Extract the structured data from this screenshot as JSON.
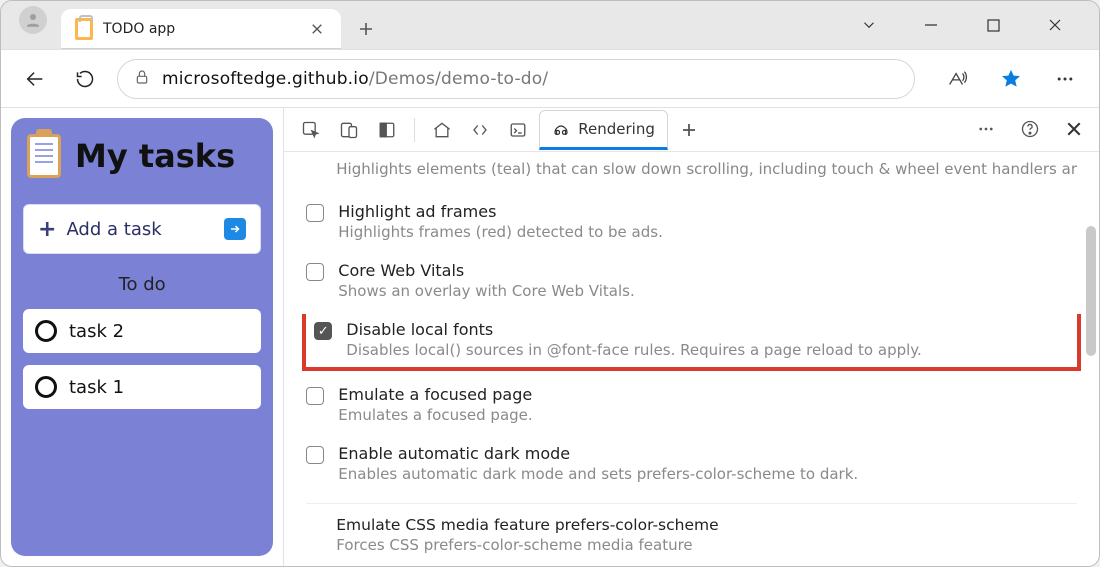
{
  "browser": {
    "tab_title": "TODO app",
    "url_host": "microsoftedge.github.io",
    "url_path": "/Demos/demo-to-do/"
  },
  "app": {
    "title": "My tasks",
    "add_label": "Add a task",
    "section_label": "To do",
    "tasks": [
      "task 2",
      "task 1"
    ]
  },
  "devtools": {
    "active_tab_label": "Rendering",
    "truncated_line": "Highlights elements (teal) that can slow down scrolling, including touch & wheel event handlers ar",
    "options": [
      {
        "title": "Highlight ad frames",
        "desc": "Highlights frames (red) detected to be ads.",
        "checked": false,
        "highlighted": false
      },
      {
        "title": "Core Web Vitals",
        "desc": "Shows an overlay with Core Web Vitals.",
        "checked": false,
        "highlighted": false
      },
      {
        "title": "Disable local fonts",
        "desc": "Disables local() sources in @font-face rules. Requires a page reload to apply.",
        "checked": true,
        "highlighted": true
      },
      {
        "title": "Emulate a focused page",
        "desc": "Emulates a focused page.",
        "checked": false,
        "highlighted": false
      },
      {
        "title": "Enable automatic dark mode",
        "desc": "Enables automatic dark mode and sets prefers-color-scheme to dark.",
        "checked": false,
        "highlighted": false
      }
    ],
    "footer_section": {
      "title": "Emulate CSS media feature prefers-color-scheme",
      "desc": "Forces CSS prefers-color-scheme media feature"
    }
  }
}
